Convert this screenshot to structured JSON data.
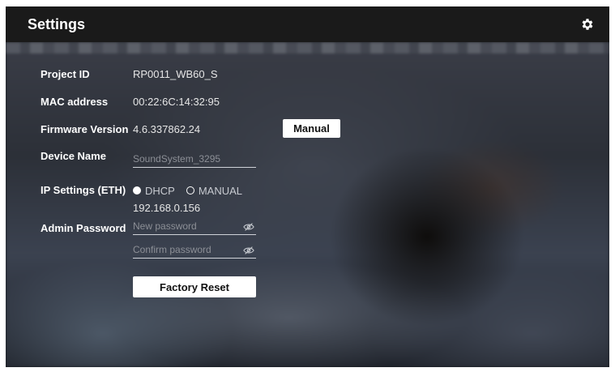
{
  "header": {
    "title": "Settings",
    "settings_icon": "gear-icon"
  },
  "rows": {
    "project_id": {
      "label": "Project ID",
      "value": "RP0011_WB60_S"
    },
    "mac_address": {
      "label": "MAC address",
      "value": "00:22:6C:14:32:95"
    },
    "firmware": {
      "label": "Firmware Version",
      "value": "4.6.337862.24",
      "button": "Manual"
    },
    "device_name": {
      "label": "Device Name",
      "placeholder": "SoundSystem_3295"
    },
    "ip_settings": {
      "label": "IP Settings (ETH)",
      "options": [
        "DHCP",
        "MANUAL"
      ],
      "selected": "DHCP",
      "address": "192.168.0.156"
    },
    "admin_password": {
      "label": "Admin Password",
      "new_placeholder": "New password",
      "confirm_placeholder": "Confirm password",
      "visibility_icon": "eye-off-icon"
    }
  },
  "actions": {
    "factory_reset": "Factory Reset"
  },
  "colors": {
    "titlebar": "#1a1a1a",
    "text": "#ffffff",
    "button_bg": "#ffffff"
  }
}
